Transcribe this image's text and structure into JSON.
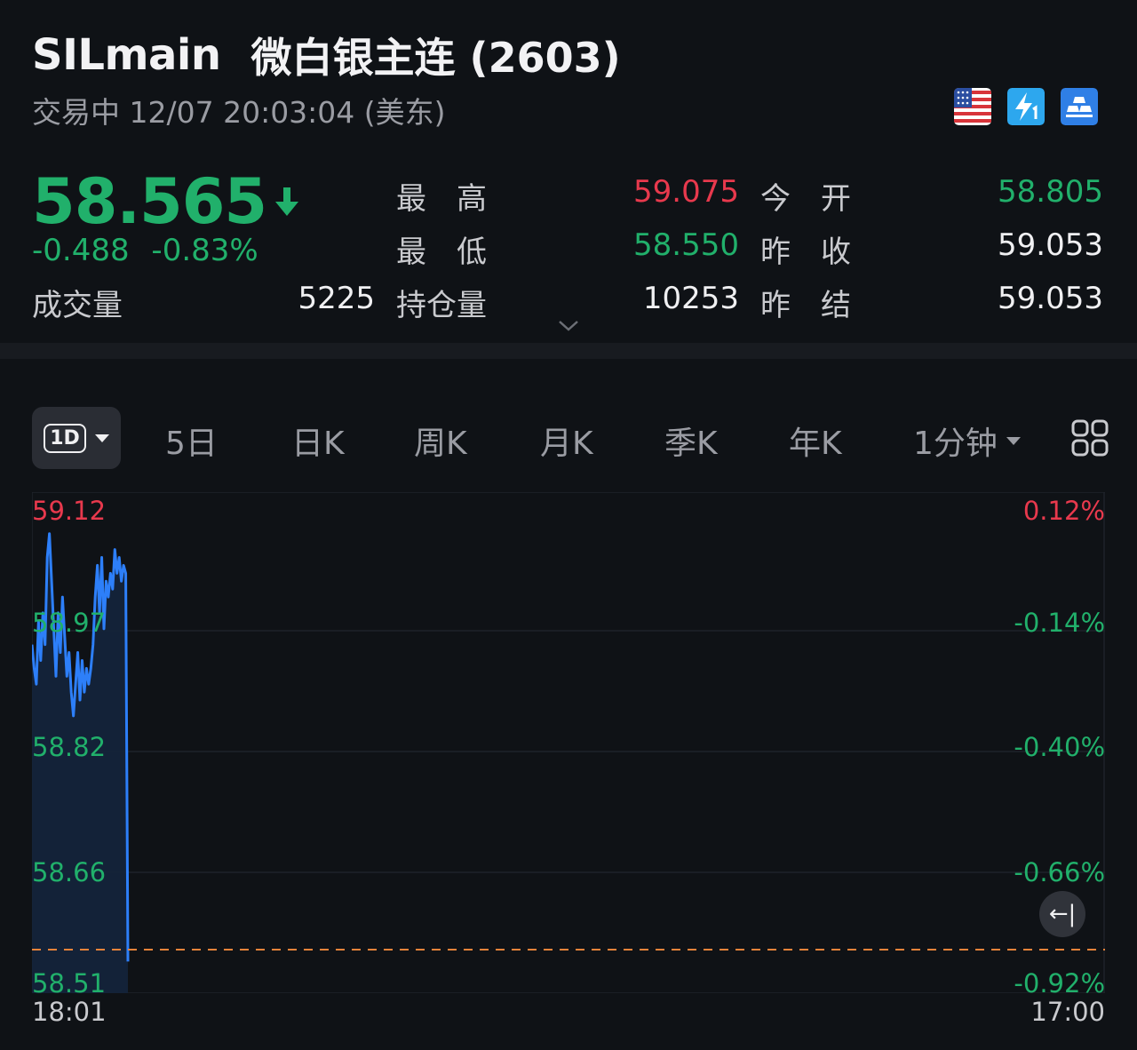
{
  "header": {
    "symbol": "SILmain",
    "name": "微白银主连 (2603)",
    "status": "交易中 12/07 20:03:04 (美东)"
  },
  "quote": {
    "price": "58.565",
    "change": "-0.488",
    "change_pct": "-0.83%",
    "volume_label": "成交量",
    "volume": "5225"
  },
  "stats": {
    "high_label": "最　高",
    "high": "59.075",
    "low_label": "最　低",
    "low": "58.550",
    "oi_label": "持仓量",
    "oi": "10253",
    "open_label": "今　开",
    "open": "58.805",
    "prev_close_label": "昨　收",
    "prev_close": "59.053",
    "prev_settle_label": "昨　结",
    "prev_settle": "59.053"
  },
  "tabs": {
    "intraday": "1D",
    "items": [
      "5日",
      "日K",
      "周K",
      "月K",
      "季K",
      "年K",
      "1分钟"
    ]
  },
  "colors": {
    "up": "#e8394d",
    "down": "#21b06b",
    "line": "#2d7ff9",
    "ref": "#e8833a"
  },
  "chart_data": {
    "type": "line",
    "y_labels": [
      "59.12",
      "58.97",
      "58.82",
      "58.66",
      "58.51"
    ],
    "y_pct_labels": [
      "0.12%",
      "-0.14%",
      "-0.40%",
      "-0.66%",
      "-0.92%"
    ],
    "x_labels": [
      "18:01",
      "17:00"
    ],
    "ylim": [
      58.51,
      59.12
    ],
    "reference_price": 58.565,
    "series": [
      {
        "values": [
          58.95,
          58.92,
          58.9,
          58.98,
          58.93,
          58.99,
          58.95,
          59.06,
          59.09,
          59.03,
          58.97,
          58.91,
          58.99,
          58.94,
          59.01,
          58.96,
          58.91,
          58.94,
          58.89,
          58.86,
          58.9,
          58.94,
          58.88,
          58.93,
          58.89,
          58.92,
          58.9,
          58.92,
          58.95,
          59.01,
          59.05,
          58.99,
          59.06,
          58.97,
          59.03,
          59.01,
          59.04,
          59.02,
          59.07,
          59.04,
          59.06,
          59.03,
          59.05,
          59.04,
          58.55
        ]
      }
    ]
  }
}
